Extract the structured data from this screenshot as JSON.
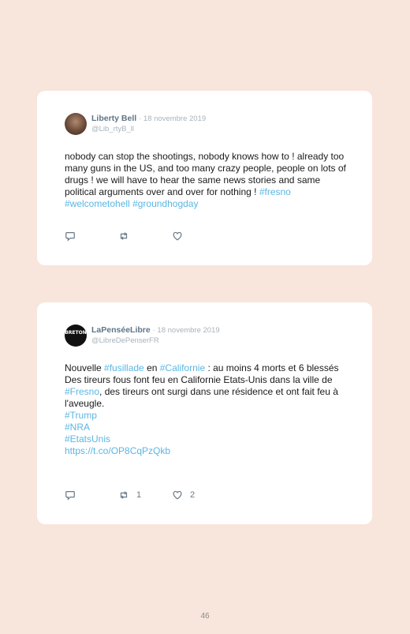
{
  "tweets": [
    {
      "name": "Liberty Bell",
      "date": "· 18 novembre 2019",
      "handle": "@Lib_rtyB_ll",
      "text_parts": [
        "nobody can stop the shootings, nobody knows how to ! already too many guns in the US, and too many crazy people, people on lots of drugs ! we will have to hear the same news stories and same political arguments over and over for nothing ! ",
        "#fresno",
        " ",
        "#welcometohell",
        " ",
        "#groundhogday"
      ],
      "retweets": "",
      "likes": ""
    },
    {
      "name": "LaPenséeLibre",
      "date": "· 18 novembre 2019",
      "handle": "@LibreDePenserFR",
      "avatar_text": "BRETON",
      "text_parts": [
        "Nouvelle ",
        "#fusillade",
        " en ",
        "#Californie",
        " : au moins 4 morts et 6 blessés",
        "Des tireurs fous font feu en Californie Etats-Unis dans la ville de ",
        "#Fresno",
        ", des tireurs ont surgi dans une résidence et ont fait feu à l'aveugle.",
        "#Trump",
        "#NRA",
        "#EtatsUnis",
        "https://t.co/OP8CqPzQkb"
      ],
      "retweets": "1",
      "likes": "2"
    }
  ],
  "icons": [
    "reply-icon",
    "retweet-icon",
    "like-icon"
  ],
  "colors": {
    "background": "#f8e5db",
    "link": "#5bb6e3",
    "card": "#ffffff"
  },
  "page_number": "46"
}
